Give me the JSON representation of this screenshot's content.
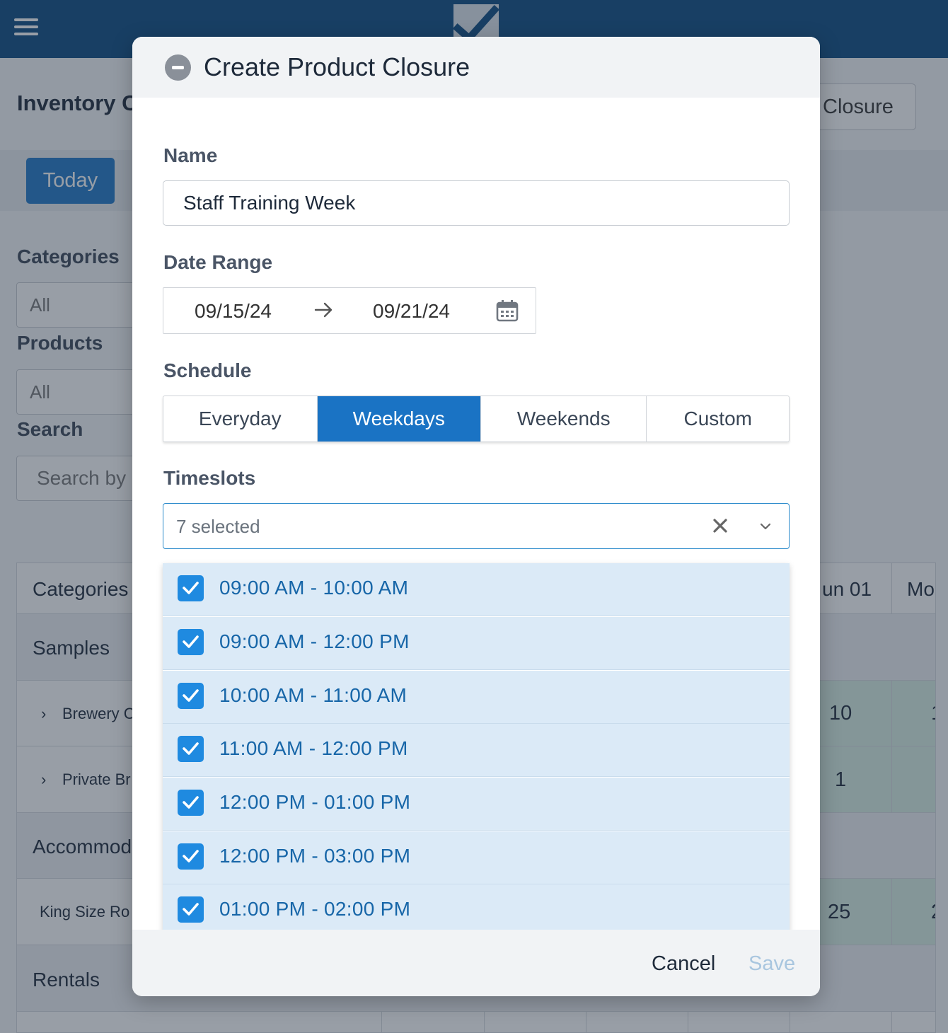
{
  "background": {
    "page_title": "Inventory C",
    "closure_button": "Closure",
    "today_button": "Today",
    "filters": {
      "categories_label": "Categories",
      "categories_value": "All",
      "products_label": "Products",
      "products_value": "All",
      "search_label": "Search",
      "search_placeholder": "Search by"
    },
    "table": {
      "header_col": "Categories",
      "header_date1": "un 01",
      "header_date2": "Mo",
      "rows": [
        {
          "label": "Samples"
        },
        {
          "label": "Brewery C",
          "value": "10",
          "value2": "1"
        },
        {
          "label": "Private Br",
          "value": "1"
        },
        {
          "label": "Accommod"
        },
        {
          "label": "King Size Ro",
          "value": "25",
          "value2": "2"
        },
        {
          "label": "Rentals"
        }
      ]
    }
  },
  "modal": {
    "title": "Create Product Closure",
    "name_label": "Name",
    "name_value": "Staff Training Week",
    "date_range_label": "Date Range",
    "date_start": "09/15/24",
    "date_end": "09/21/24",
    "schedule_label": "Schedule",
    "schedule_options": [
      "Everyday",
      "Weekdays",
      "Weekends",
      "Custom"
    ],
    "schedule_selected": "Weekdays",
    "timeslots_label": "Timeslots",
    "timeslots_summary": "7 selected",
    "timeslots": [
      "09:00 AM - 10:00 AM",
      "09:00 AM - 12:00 PM",
      "10:00 AM - 11:00 AM",
      "11:00 AM - 12:00 PM",
      "12:00 PM - 01:00 PM",
      "12:00 PM - 03:00 PM",
      "01:00 PM - 02:00 PM"
    ],
    "cancel_label": "Cancel",
    "save_label": "Save"
  },
  "colors": {
    "brand": "#0a4a80",
    "accent": "#1a73c4",
    "checkbox": "#1f8ae0",
    "selected_row": "#dbeaf7"
  },
  "icons": [
    "menu-icon",
    "app-logo-icon",
    "collapse-icon",
    "arrow-right-icon",
    "calendar-icon",
    "clear-icon",
    "chevron-down-icon",
    "checkbox-checked-icon",
    "chevron-right-icon"
  ]
}
